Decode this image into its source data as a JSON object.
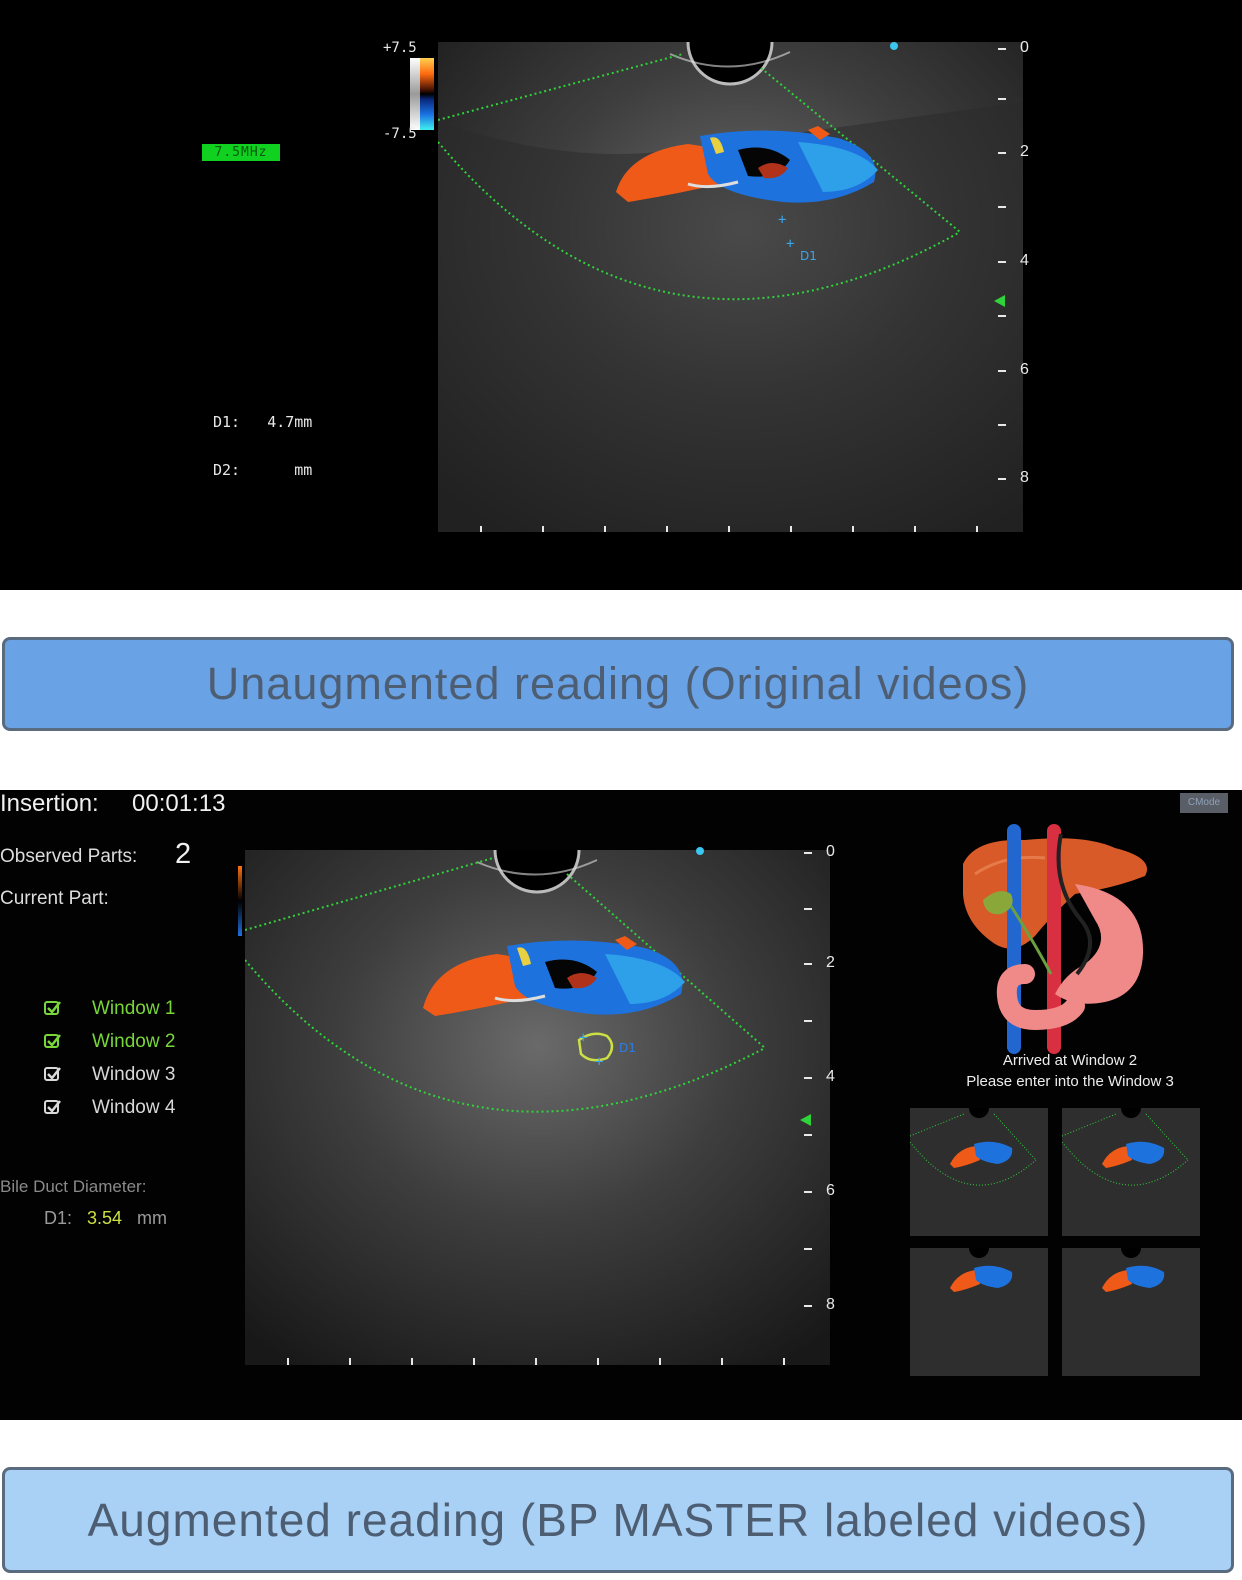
{
  "top": {
    "frequency": "7.5MHz",
    "scale_max": "+7.5",
    "scale_min": "-7.5",
    "measure_d1_label": "D1:",
    "measure_d1_value": "4.7mm",
    "measure_d2_label": "D2:",
    "measure_d2_value": "mm",
    "marker_label": "D1",
    "depth_labels": [
      "0",
      "2",
      "4",
      "6",
      "8"
    ]
  },
  "captions": {
    "unaugmented": "Unaugmented reading (Original videos)",
    "augmented": "Augmented reading (BP MASTER labeled videos)"
  },
  "bottom": {
    "insertion_label": "Insertion:",
    "insertion_time": "00:01:13",
    "observed_label": "Observed Parts:",
    "observed_count": "2",
    "current_label": "Current Part:",
    "windows": [
      {
        "label": "Window 1",
        "done": true
      },
      {
        "label": "Window 2",
        "done": true
      },
      {
        "label": "Window 3",
        "done": false
      },
      {
        "label": "Window 4",
        "done": false
      }
    ],
    "bile_label": "Bile Duct Diameter:",
    "d1_label": "D1:",
    "d1_value": "3.54",
    "d1_unit": "mm",
    "mode_badge": "CMode",
    "prompt_line1": "Arrived at Window 2",
    "prompt_line2": "Please enter into the Window 3",
    "marker_label": "D1",
    "depth_labels": [
      "0",
      "2",
      "4",
      "6",
      "8"
    ]
  },
  "colors": {
    "caption_top_bg": "#6aa2e6",
    "caption_bottom_bg": "#a9d0f5",
    "window_done": "#78d63a",
    "d1_value": "#cde043",
    "frequency_badge": "#10d020"
  },
  "icons": {
    "checkbox": "check-square-icon",
    "anatomy": "liver-stomach-anatomy-icon"
  }
}
